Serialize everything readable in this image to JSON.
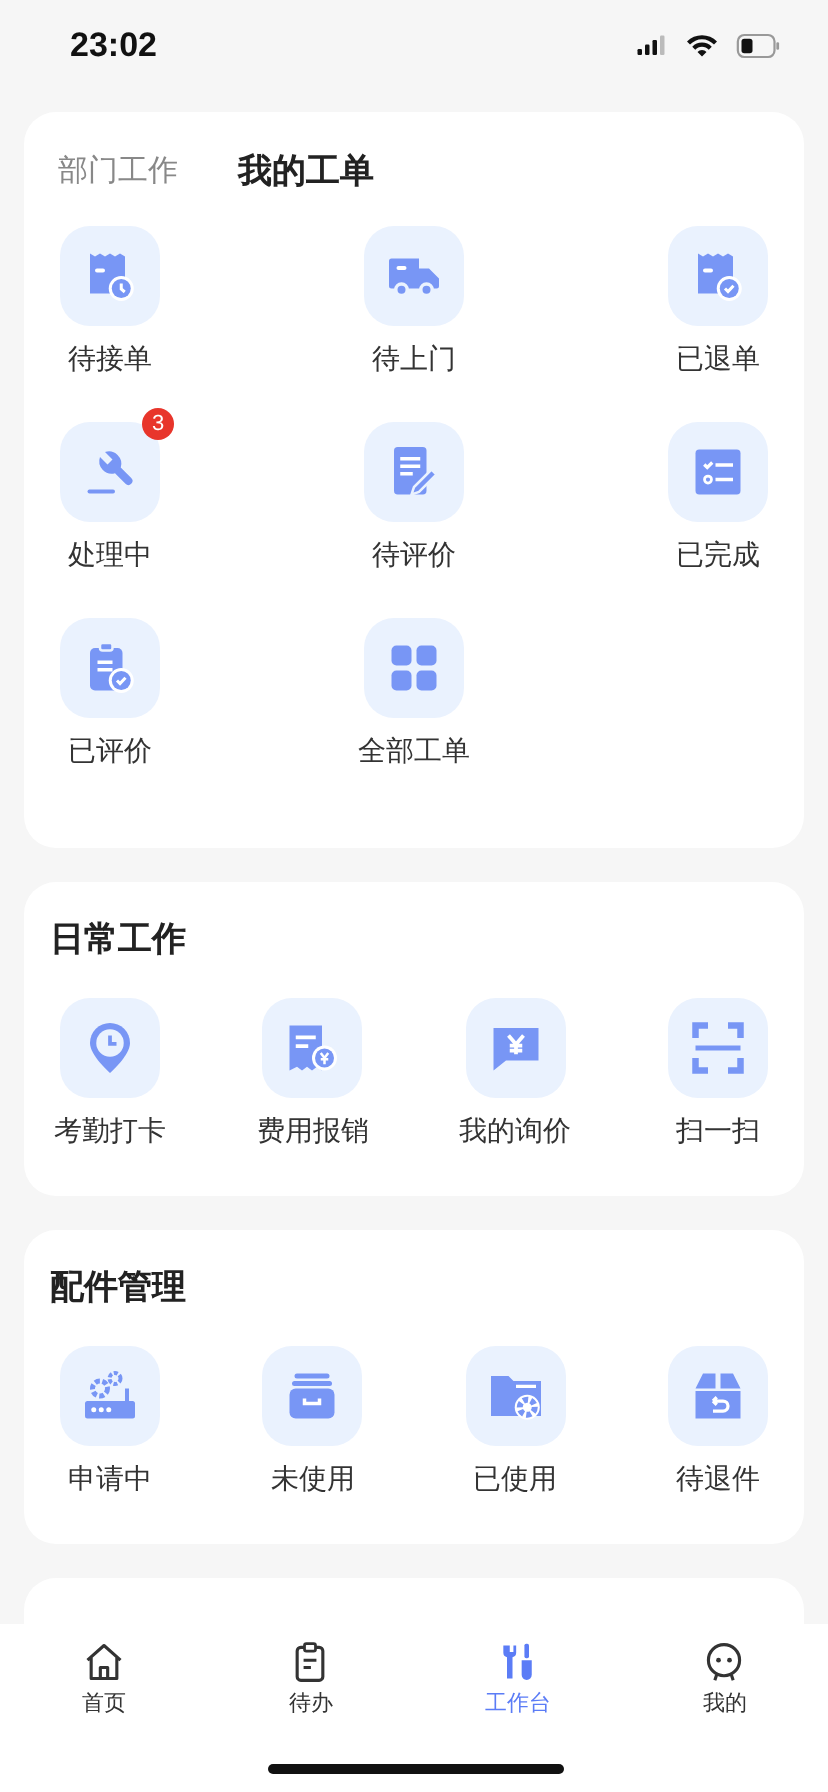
{
  "status_bar": {
    "time": "23:02"
  },
  "orders_card": {
    "tabs": [
      {
        "label": "部门工作",
        "selected": false
      },
      {
        "label": "我的工单",
        "selected": true
      }
    ],
    "items": [
      {
        "label": "待接单"
      },
      {
        "label": "待上门"
      },
      {
        "label": "已退单"
      },
      {
        "label": "处理中",
        "badge": "3"
      },
      {
        "label": "待评价"
      },
      {
        "label": "已完成"
      },
      {
        "label": "已评价"
      },
      {
        "label": "全部工单"
      }
    ]
  },
  "daily_work": {
    "title": "日常工作",
    "items": [
      {
        "label": "考勤打卡"
      },
      {
        "label": "费用报销"
      },
      {
        "label": "我的询价"
      },
      {
        "label": "扫一扫"
      }
    ]
  },
  "parts_management": {
    "title": "配件管理",
    "items": [
      {
        "label": "申请中"
      },
      {
        "label": "未使用"
      },
      {
        "label": "已使用"
      },
      {
        "label": "待退件"
      }
    ]
  },
  "tab_bar": [
    {
      "label": "首页",
      "selected": false
    },
    {
      "label": "待办",
      "selected": false
    },
    {
      "label": "工作台",
      "selected": true
    },
    {
      "label": "我的",
      "selected": false
    }
  ]
}
